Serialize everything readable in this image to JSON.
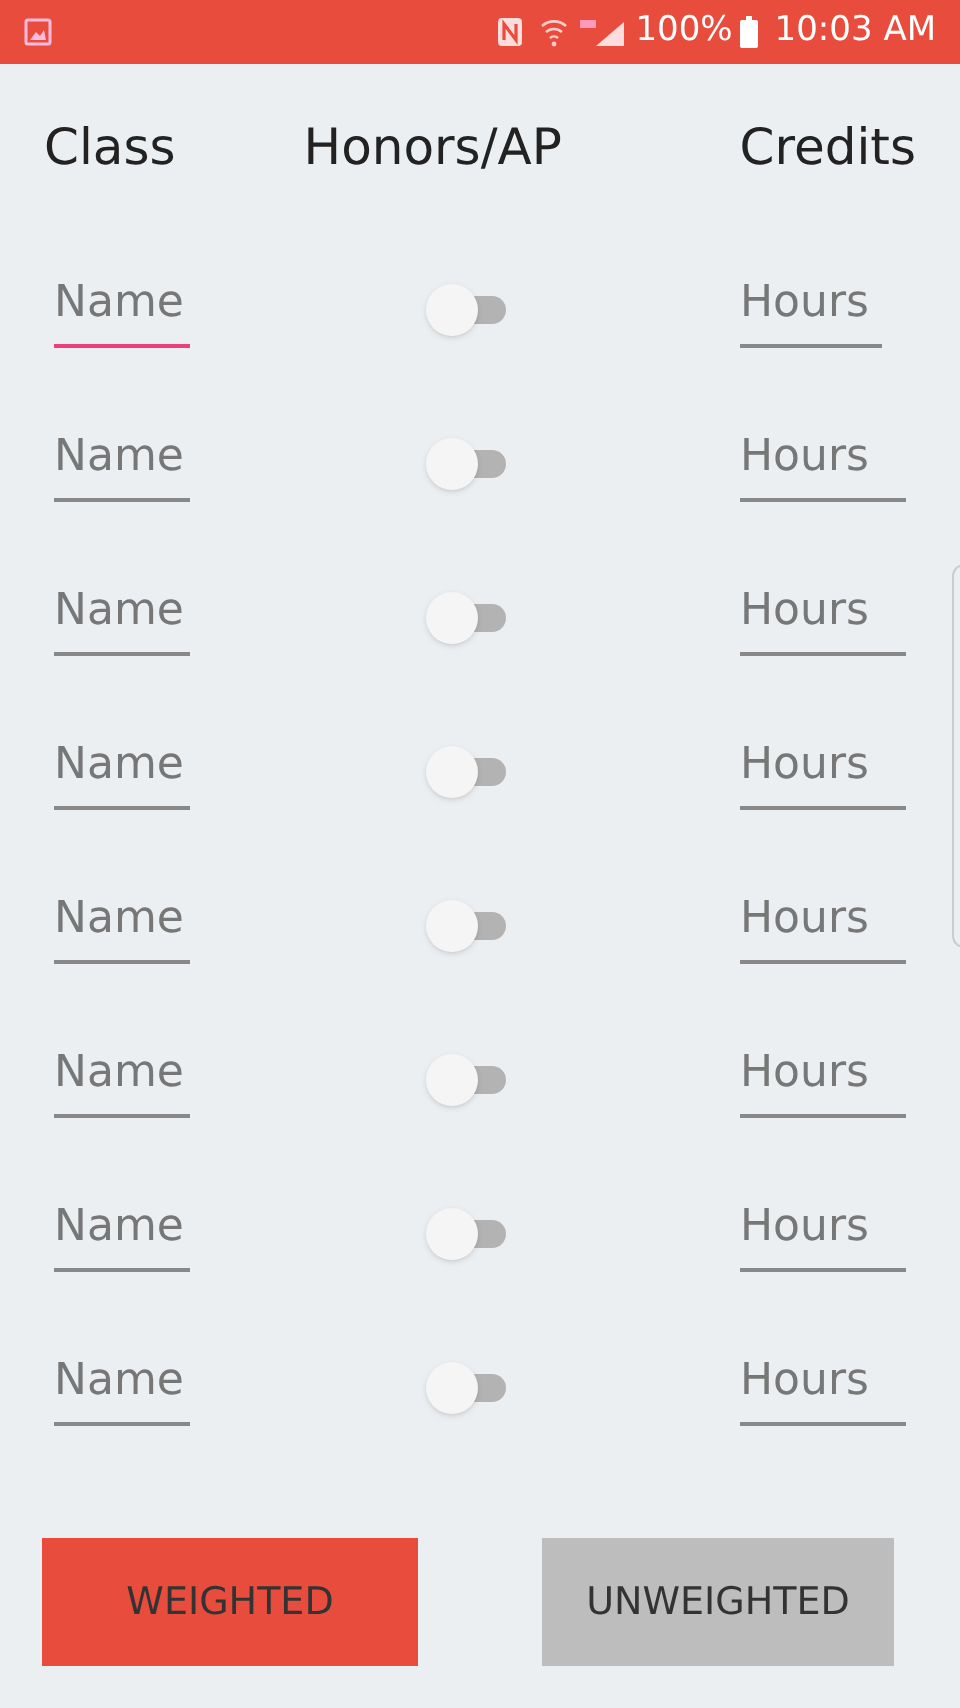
{
  "status_bar": {
    "battery": "100%",
    "time": "10:03 AM"
  },
  "columns": [
    "Class",
    "Honors/AP",
    "Credits"
  ],
  "rows": [
    {
      "name_placeholder": "Name",
      "focused": true,
      "honors": false,
      "hours_placeholder": "Hours"
    },
    {
      "name_placeholder": "Name",
      "focused": false,
      "honors": false,
      "hours_placeholder": "Hours"
    },
    {
      "name_placeholder": "Name",
      "focused": false,
      "honors": false,
      "hours_placeholder": "Hours"
    },
    {
      "name_placeholder": "Name",
      "focused": false,
      "honors": false,
      "hours_placeholder": "Hours"
    },
    {
      "name_placeholder": "Name",
      "focused": false,
      "honors": false,
      "hours_placeholder": "Hours"
    },
    {
      "name_placeholder": "Name",
      "focused": false,
      "honors": false,
      "hours_placeholder": "Hours"
    },
    {
      "name_placeholder": "Name",
      "focused": false,
      "honors": false,
      "hours_placeholder": "Hours"
    },
    {
      "name_placeholder": "Name",
      "focused": false,
      "honors": false,
      "hours_placeholder": "Hours"
    }
  ],
  "buttons": [
    {
      "label": "WEIGHTED",
      "selected": true
    },
    {
      "label": "UNWEIGHTED",
      "selected": false
    }
  ]
}
